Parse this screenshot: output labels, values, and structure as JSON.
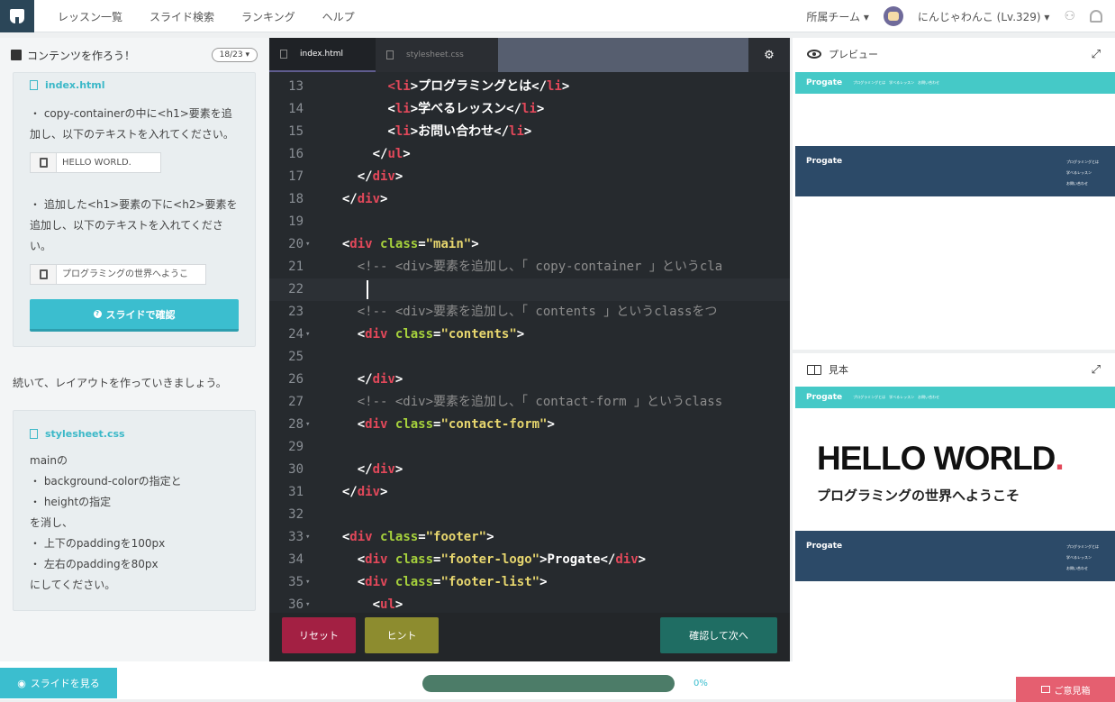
{
  "nav": {
    "items": [
      "レッスン一覧",
      "スライド検索",
      "ランキング",
      "ヘルプ"
    ],
    "team_label": "所属チーム ▾",
    "user_label": "にんじゃわんこ (Lv.329) ▾"
  },
  "left": {
    "title": "コンテンツを作ろう！",
    "counter": "18/23 ▾",
    "card1": {
      "file": "index.html",
      "instr1": "・ copy-containerの中に<h1>要素を追加し、以下のテキストを入れてください。",
      "copy1": "HELLO WORLD.",
      "instr2": "・ 追加した<h1>要素の下に<h2>要素を追加し、以下のテキストを入れてください。",
      "copy2": "プログラミングの世界へようこ",
      "button": "スライドで確認"
    },
    "between_text": "続いて、レイアウトを作っていきましょう。",
    "card2": {
      "file": "stylesheet.css",
      "lines": [
        "mainの",
        "・ background-colorの指定と",
        "・ heightの指定",
        "を消し、",
        "・ 上下のpaddingを100px",
        "・ 左右のpaddingを80px",
        "にしてください。"
      ]
    }
  },
  "editor": {
    "tabs": [
      "index.html",
      "stylesheet.css"
    ],
    "gear": "⚙",
    "lines": [
      {
        "n": "13",
        "fold": "",
        "html": "        <span class='tg'>&lt;</span><span class='tg'>li</span>&gt;プログラミングとは&lt;/<span class='tg'>li</span>&gt;"
      },
      {
        "n": "14",
        "fold": "",
        "html": "        &lt;<span class='tg'>li</span>&gt;学べるレッスン&lt;/<span class='tg'>li</span>&gt;"
      },
      {
        "n": "15",
        "fold": "",
        "html": "        &lt;<span class='tg'>li</span>&gt;お問い合わせ&lt;/<span class='tg'>li</span>&gt;"
      },
      {
        "n": "16",
        "fold": "",
        "html": "      &lt;/<span class='tg'>ul</span>&gt;"
      },
      {
        "n": "17",
        "fold": "",
        "html": "    &lt;/<span class='tg'>div</span>&gt;"
      },
      {
        "n": "18",
        "fold": "",
        "html": "  &lt;/<span class='tg'>div</span>&gt;"
      },
      {
        "n": "19",
        "fold": "",
        "html": ""
      },
      {
        "n": "20",
        "fold": "▾",
        "html": "  &lt;<span class='tg'>div</span> <span class='at'>class</span>=<span class='st'>\"main\"</span>&gt;"
      },
      {
        "n": "21",
        "fold": "",
        "html": "    <span class='cm'>&lt;!-- &lt;div&gt;要素を追加し、「 copy-container 」というcla</span>"
      },
      {
        "n": "22",
        "fold": "",
        "html": "",
        "current": true
      },
      {
        "n": "23",
        "fold": "",
        "html": "    <span class='cm'>&lt;!-- &lt;div&gt;要素を追加し、「 contents 」というclassをつ</span>"
      },
      {
        "n": "24",
        "fold": "▾",
        "html": "    &lt;<span class='tg'>div</span> <span class='at'>class</span>=<span class='st'>\"contents\"</span>&gt;"
      },
      {
        "n": "25",
        "fold": "",
        "html": ""
      },
      {
        "n": "26",
        "fold": "",
        "html": "    &lt;/<span class='tg'>div</span>&gt;"
      },
      {
        "n": "27",
        "fold": "",
        "html": "    <span class='cm'>&lt;!-- &lt;div&gt;要素を追加し、「 contact-form 」というclass</span>"
      },
      {
        "n": "28",
        "fold": "▾",
        "html": "    &lt;<span class='tg'>div</span> <span class='at'>class</span>=<span class='st'>\"contact-form\"</span>&gt;"
      },
      {
        "n": "29",
        "fold": "",
        "html": ""
      },
      {
        "n": "30",
        "fold": "",
        "html": "    &lt;/<span class='tg'>div</span>&gt;"
      },
      {
        "n": "31",
        "fold": "",
        "html": "  &lt;/<span class='tg'>div</span>&gt;"
      },
      {
        "n": "32",
        "fold": "",
        "html": ""
      },
      {
        "n": "33",
        "fold": "▾",
        "html": "  &lt;<span class='tg'>div</span> <span class='at'>class</span>=<span class='st'>\"footer\"</span>&gt;"
      },
      {
        "n": "34",
        "fold": "",
        "html": "    &lt;<span class='tg'>div</span> <span class='at'>class</span>=<span class='st'>\"footer-logo\"</span>&gt;Progate&lt;/<span class='tg'>div</span>&gt;"
      },
      {
        "n": "35",
        "fold": "▾",
        "html": "    &lt;<span class='tg'>div</span> <span class='at'>class</span>=<span class='st'>\"footer-list\"</span>&gt;"
      },
      {
        "n": "36",
        "fold": "▾",
        "html": "      &lt;<span class='tg'>ul</span>&gt;"
      }
    ],
    "reset": "リセット",
    "hint": "ヒント",
    "next": "確認して次へ"
  },
  "preview": {
    "title": "プレビュー",
    "logo": "Progate",
    "nav_text": "プログラミングとは　学べるレッスン　お問い合わせ",
    "footer_logo": "Progate",
    "footer_list": [
      "プログラミングとは",
      "学べるレッスン",
      "お問い合わせ"
    ]
  },
  "sample": {
    "title": "見本",
    "logo": "Progate",
    "nav_text": "プログラミングとは　学べるレッスン　お問い合わせ",
    "heading": "HELLO WORLD",
    "heading_dot": ".",
    "subheading": "プログラミングの世界へようこそ",
    "footer_logo": "Progate",
    "footer_list": [
      "プログラミングとは",
      "学べるレッスン",
      "お問い合わせ"
    ]
  },
  "bottom": {
    "slides_button": "スライドを見る",
    "progress_percent": "0%",
    "progress_value": 0,
    "feedback": "ご意見箱"
  },
  "colors": {
    "accent": "#3bbecf",
    "editor_bg": "#262a2e",
    "preview_header": "#45c9c7",
    "preview_footer": "#2c4a68",
    "reset": "#a32043",
    "hint": "#8d8c2f",
    "next": "#1f6d63",
    "feedback": "#e55f70"
  }
}
